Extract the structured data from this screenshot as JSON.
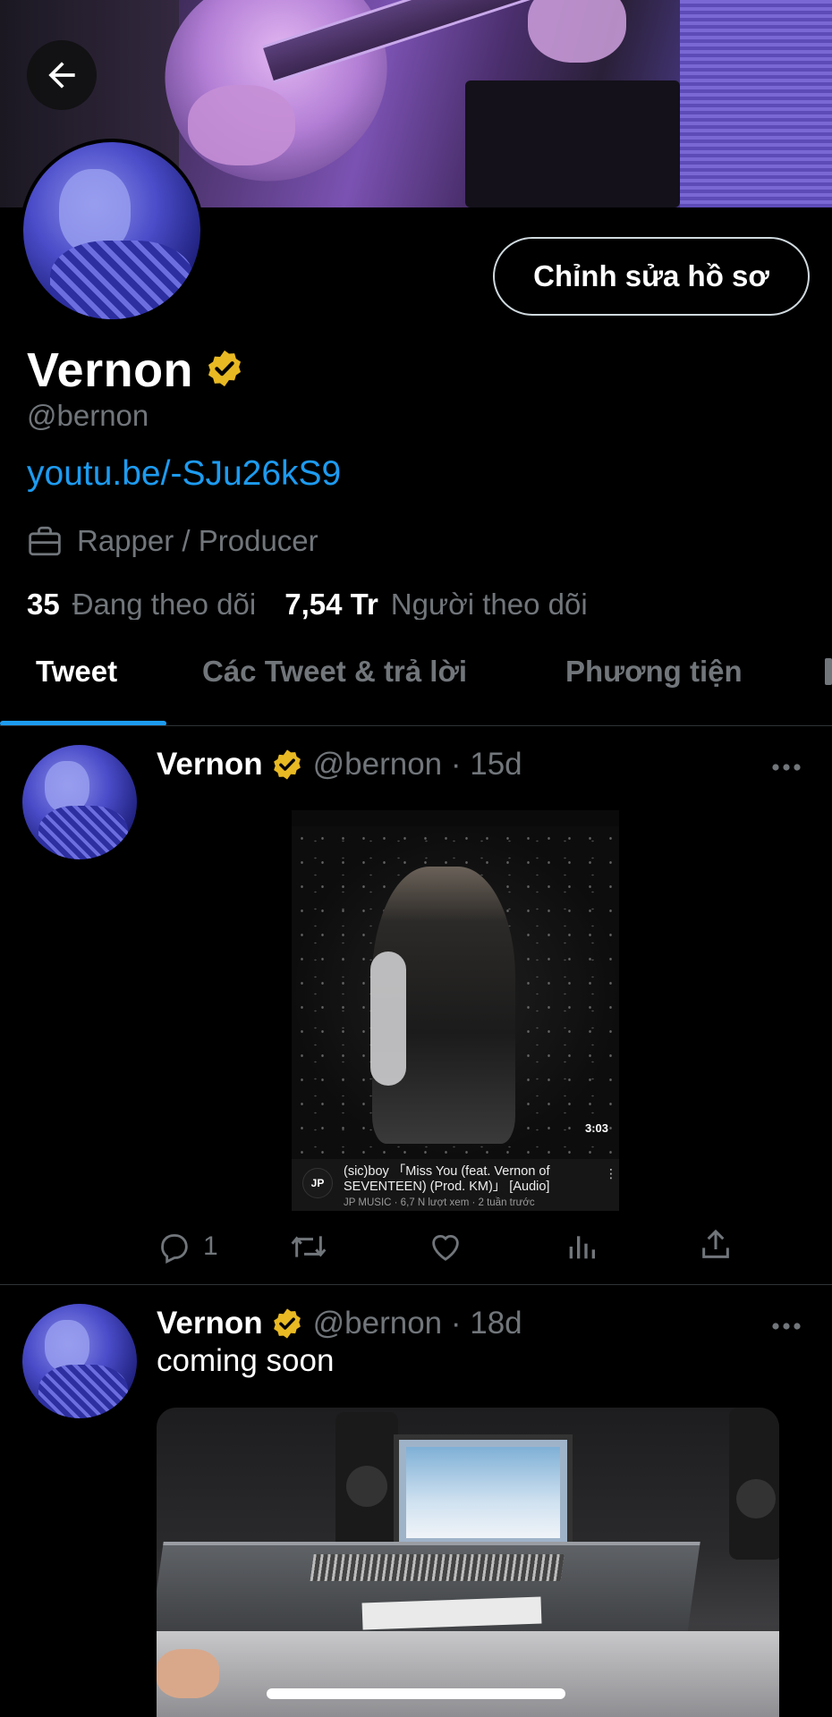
{
  "profile": {
    "display_name": "Vernon",
    "handle": "@bernon",
    "link": "youtu.be/-SJu26kS9",
    "job": "Rapper / Producer",
    "edit_button": "Chỉnh sửa hồ sơ",
    "following_count": "35",
    "following_label": "Đang theo dõi",
    "followers_count": "7,54 Tr",
    "followers_label": "Người theo dõi"
  },
  "tabs": [
    {
      "label": "Tweet",
      "active": true
    },
    {
      "label": "Các Tweet & trả lời",
      "active": false
    },
    {
      "label": "Phương tiện",
      "active": false
    }
  ],
  "tweets": [
    {
      "name": "Vernon",
      "meta": "@bernon · 15d",
      "video_card": {
        "duration": "3:03",
        "channel_logo": "JP",
        "title": "(sic)boy 「Miss You (feat. Vernon of SEVENTEEN) (Prod. KM)」 [Audio]",
        "subtitle": "JP MUSIC · 6,7 N lượt xem · 2 tuần trước"
      },
      "reply_count": "1"
    },
    {
      "name": "Vernon",
      "meta": "@bernon · 18d",
      "text": "coming soon"
    }
  ],
  "colors": {
    "background": "#000000",
    "accent": "#1d9bf0",
    "muted": "#71767b",
    "verified_badge": "#e8b923"
  },
  "icons": [
    "back-arrow-icon",
    "verified-badge-icon",
    "briefcase-icon",
    "more-icon",
    "reply-icon",
    "retweet-icon",
    "like-icon",
    "views-icon",
    "share-icon"
  ]
}
